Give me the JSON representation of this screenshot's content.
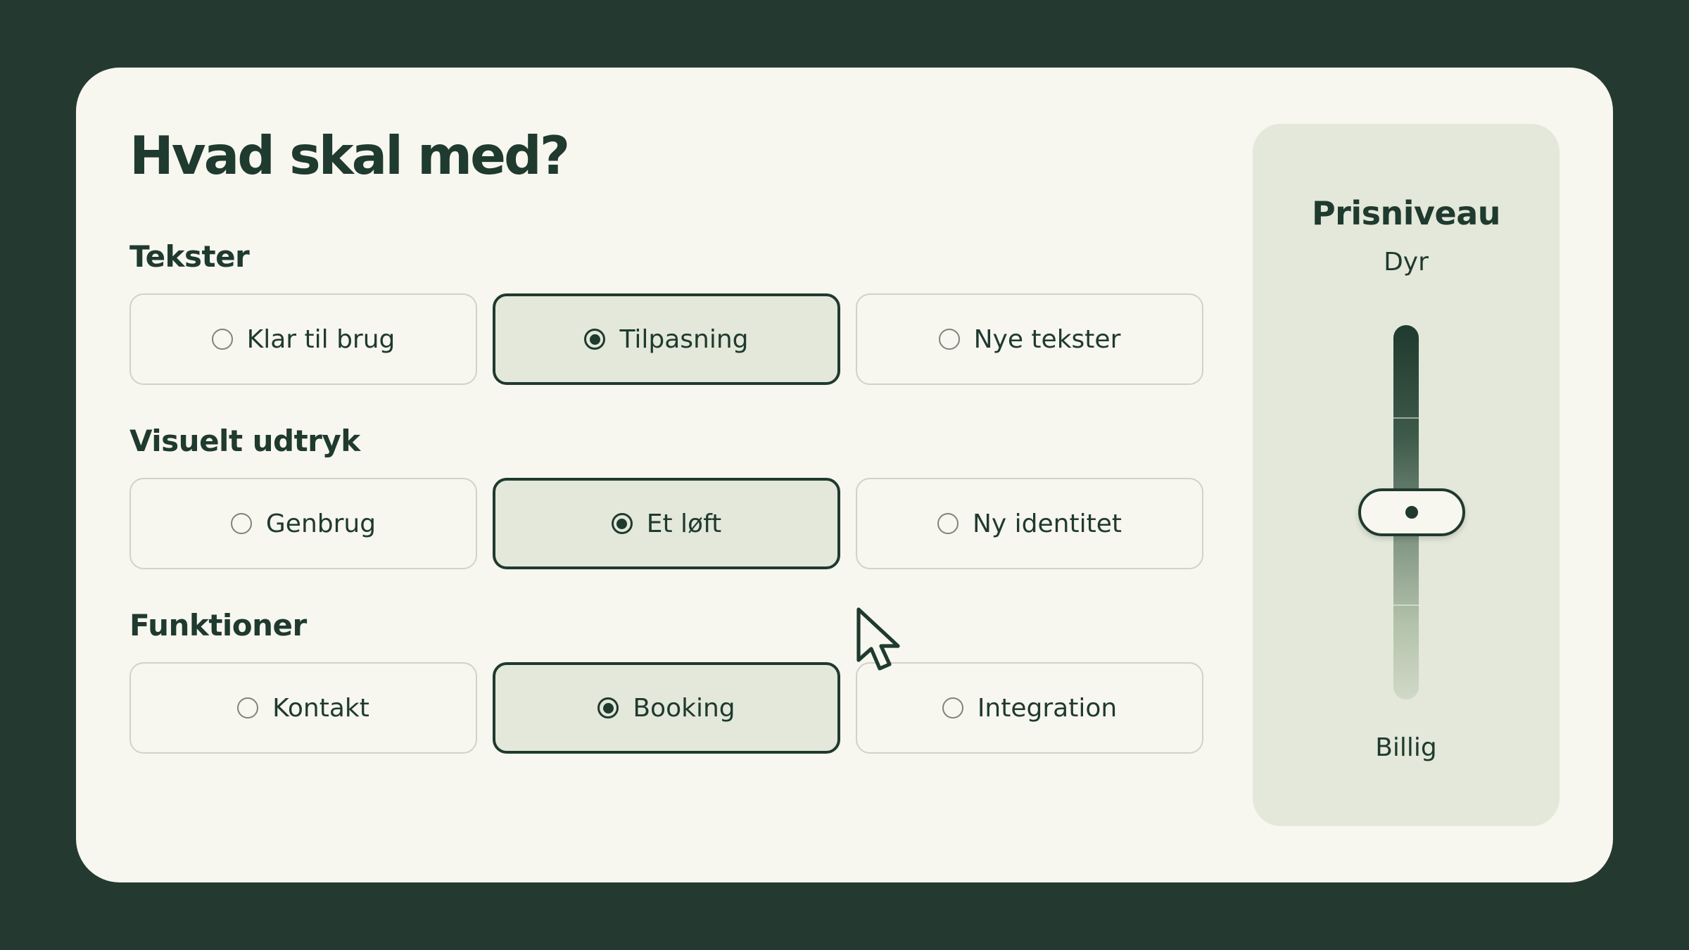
{
  "title": "Hvad skal med?",
  "sections": [
    {
      "label": "Tekster",
      "options": [
        {
          "label": "Klar til brug",
          "selected": false
        },
        {
          "label": "Tilpasning",
          "selected": true
        },
        {
          "label": "Nye tekster",
          "selected": false
        }
      ]
    },
    {
      "label": "Visuelt udtryk",
      "options": [
        {
          "label": "Genbrug",
          "selected": false
        },
        {
          "label": "Et løft",
          "selected": true
        },
        {
          "label": "Ny identitet",
          "selected": false
        }
      ]
    },
    {
      "label": "Funktioner",
      "options": [
        {
          "label": "Kontakt",
          "selected": false
        },
        {
          "label": "Booking",
          "selected": true
        },
        {
          "label": "Integration",
          "selected": false
        }
      ]
    }
  ],
  "price": {
    "title": "Prisniveau",
    "top_label": "Dyr",
    "bottom_label": "Billig",
    "level": 0.5
  },
  "colors": {
    "background": "#243a30",
    "card": "#f7f6ef",
    "accent": "#1f3a2e",
    "selected_fill": "#e3e8da",
    "panel": "#e3e8da"
  },
  "icons": {
    "cursor": "mouse-pointer-icon",
    "radio_on": "radio-selected-icon",
    "radio_off": "radio-unselected-icon"
  }
}
